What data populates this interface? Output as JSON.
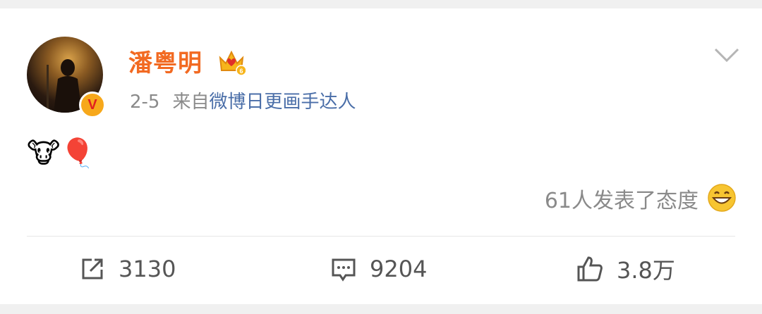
{
  "post": {
    "username": "潘粤明",
    "date": "2-5",
    "source_prefix": "来自",
    "source_name": "微博日更画手达人",
    "verified_badge": "V",
    "body_emojis": [
      "🐮",
      "🎈"
    ],
    "attitude_text": "61人发表了态度",
    "attitude_icon": "grinning-emoji-icon"
  },
  "actions": {
    "repost_count": "3130",
    "comment_count": "9204",
    "like_count": "3.8万"
  },
  "colors": {
    "username": "#f26a22",
    "source_link": "#4a6ea8",
    "muted_text": "#8a8a8a",
    "verified_badge": "#f7a81b",
    "background": "#f0f0f0"
  }
}
